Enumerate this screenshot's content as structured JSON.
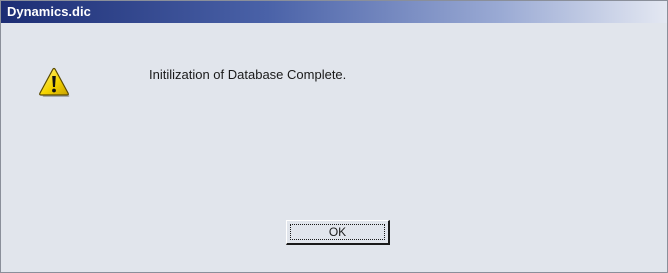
{
  "window": {
    "title": "Dynamics.dic"
  },
  "dialog": {
    "icon": "warning-icon",
    "message": "Initilization of Database Complete.",
    "ok_label": "OK"
  },
  "colors": {
    "title_bar_start": "#1c2d74",
    "title_bar_end": "#e4e8f2",
    "dialog_background": "#e1e5ec",
    "warning_fill": "#f5d400"
  }
}
